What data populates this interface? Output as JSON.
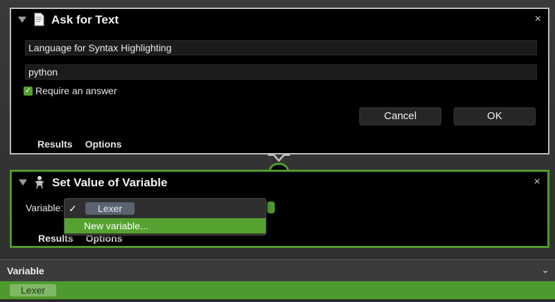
{
  "action1": {
    "title": "Ask for Text",
    "icon": "script-page-icon",
    "question_value": "Language for Syntax Highlighting",
    "default_value": "python",
    "require_answer": {
      "label": "Require an answer",
      "checked": true
    },
    "buttons": {
      "cancel": "Cancel",
      "ok": "OK"
    },
    "tabs": [
      "Results",
      "Options"
    ],
    "close": "×"
  },
  "action2": {
    "title": "Set Value of Variable",
    "icon": "robot-icon",
    "variable_label": "Variable:",
    "tabs": [
      "Results",
      "Options"
    ],
    "close": "×",
    "menu": {
      "items": [
        {
          "label": "Lexer",
          "checked": true,
          "check_glyph": "✓"
        },
        {
          "label": "New variable...",
          "highlighted": true
        }
      ]
    }
  },
  "variables_panel": {
    "title": "Variable",
    "chevron": "⌄",
    "rows": [
      "Lexer"
    ]
  },
  "colors": {
    "accent_green": "#4f9a2f",
    "token_grey": "#5b6370",
    "card_bg": "#000000"
  }
}
